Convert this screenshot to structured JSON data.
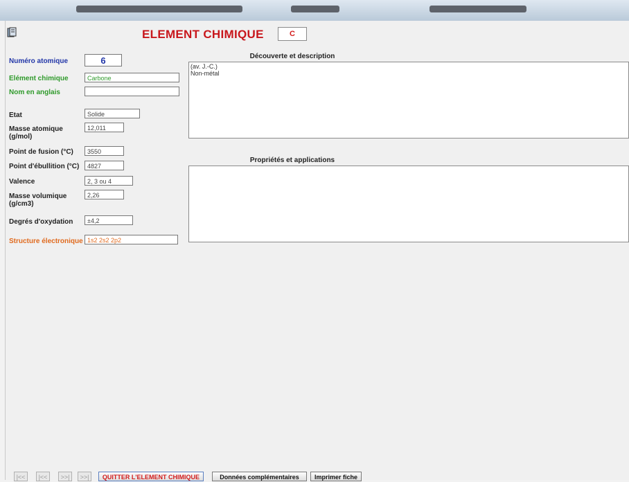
{
  "header": {
    "title": "ELEMENT CHIMIQUE",
    "symbol": "C"
  },
  "fields": {
    "numero_label": "Numéro atomique",
    "numero_value": "6",
    "element_label": "Elément chimique",
    "element_value": "Carbone",
    "anglais_label": "Nom en anglais",
    "anglais_value": "",
    "etat_label": "Etat",
    "etat_value": "Solide",
    "masse_label_1": "Masse atomique",
    "masse_label_2": "(g/mol)",
    "masse_value": "12,011",
    "fusion_label": "Point de fusion (°C)",
    "fusion_value": "3550",
    "ebullition_label": "Point d'ébullition (°C)",
    "ebullition_value": "4827",
    "valence_label": "Valence",
    "valence_value": "2, 3 ou 4",
    "volumique_label_1": "Masse volumique",
    "volumique_label_2": "(g/cm3)",
    "volumique_value": "2,26",
    "oxydation_label": "Degrés d'oxydation",
    "oxydation_value": "±4,2",
    "structure_label": "Structure électronique",
    "structure_value": "1s2  2s2  2p2"
  },
  "decouverte": {
    "title": "Découverte et description",
    "line1": "(av. J.-C.)",
    "line2": "Non-métal"
  },
  "proprietes": {
    "title": "Propriétés et applications",
    "text": ""
  },
  "buttons": {
    "first": "|<<",
    "prev": "|<<",
    "next": ">>|",
    "last": ">>|",
    "quit": "QUITTER L'ELEMENT CHIMIQUE",
    "donnees": "Données complémentaires",
    "imprimer": "Imprimer fiche"
  },
  "colors": {
    "title_red": "#c8171c",
    "label_blue": "#2236a8",
    "label_green": "#2f9a2b",
    "label_orange": "#e06a1e"
  },
  "icons": {
    "app": "document-icon"
  }
}
